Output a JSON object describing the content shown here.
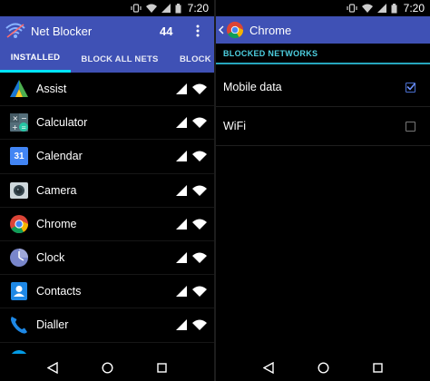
{
  "status_bar": {
    "time_left": "7:20",
    "time_right": "7:20"
  },
  "left_screen": {
    "app_title": "Net Blocker",
    "count": "44",
    "tabs": [
      {
        "label": "INSTALLED",
        "active": true
      },
      {
        "label": "BLOCK ALL NETS",
        "active": false
      },
      {
        "label": "BLOCK DA",
        "active": false
      }
    ],
    "apps": [
      {
        "name": "Assist",
        "icon": "assist-icon"
      },
      {
        "name": "Calculator",
        "icon": "calculator-icon"
      },
      {
        "name": "Calendar",
        "icon": "calendar-icon",
        "icon_text": "31"
      },
      {
        "name": "Camera",
        "icon": "camera-icon"
      },
      {
        "name": "Chrome",
        "icon": "chrome-icon"
      },
      {
        "name": "Clock",
        "icon": "clock-icon"
      },
      {
        "name": "Contacts",
        "icon": "contacts-icon"
      },
      {
        "name": "Dialler",
        "icon": "phone-icon"
      }
    ]
  },
  "right_screen": {
    "app_title": "Chrome",
    "section_header": "BLOCKED NETWORKS",
    "options": [
      {
        "label": "Mobile data",
        "checked": true
      },
      {
        "label": "WiFi",
        "checked": false
      }
    ]
  },
  "colors": {
    "primary": "#3f51b5",
    "tab_indicator": "#00e5ff",
    "section_accent": "#4dd0e1",
    "checkbox_accent": "#4a6fd0"
  }
}
